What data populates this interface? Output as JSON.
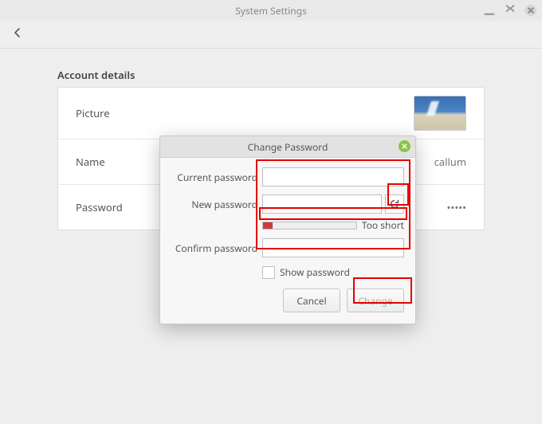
{
  "titlebar": {
    "title": "System Settings"
  },
  "section": {
    "title": "Account details"
  },
  "rows": {
    "picture_label": "Picture",
    "name_label": "Name",
    "name_value": "callum",
    "password_label": "Password",
    "password_value": "•••••"
  },
  "dialog": {
    "title": "Change Password",
    "current_label": "Current password",
    "new_label": "New password",
    "confirm_label": "Confirm password",
    "strength_label": "Too short",
    "show_password_label": "Show password",
    "cancel": "Cancel",
    "change": "Change",
    "current_value": "",
    "new_value": "",
    "confirm_value": ""
  }
}
